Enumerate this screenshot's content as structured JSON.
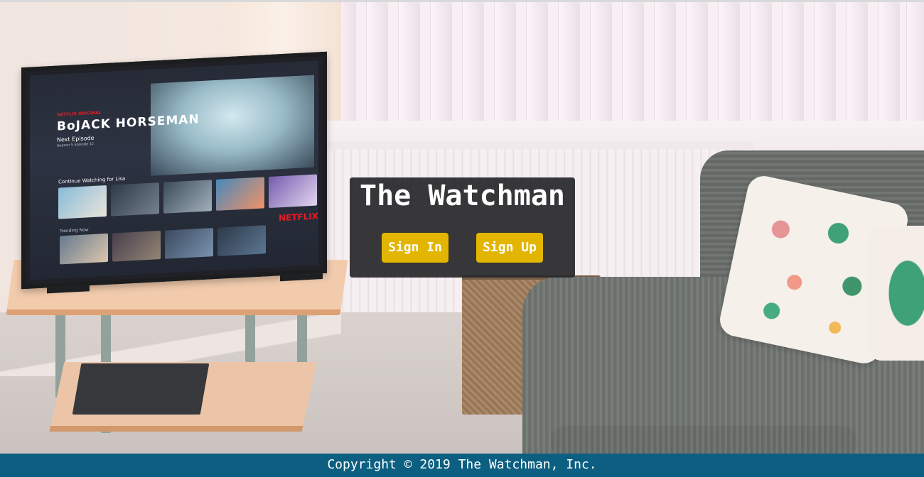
{
  "page": {
    "title": "The Watchman"
  },
  "panel": {
    "title": "The Watchman",
    "sign_in_label": "Sign In",
    "sign_up_label": "Sign Up"
  },
  "tv": {
    "brand": "NETFLIX ORIGINAL",
    "show_title": "BoJACK HORSEMAN",
    "next_episode": "Next Episode",
    "episode_info": "Season 5 Episode 12",
    "continue_watching": "Continue Watching for Lisa",
    "trending_now": "Trending Now",
    "logo": "NETFLIX"
  },
  "footer": {
    "copyright": "Copyright © 2019 The Watchman, Inc."
  },
  "colors": {
    "button_bg": "#e2b500",
    "panel_bg": "#28282b",
    "footer_bg": "#0c5f80"
  }
}
